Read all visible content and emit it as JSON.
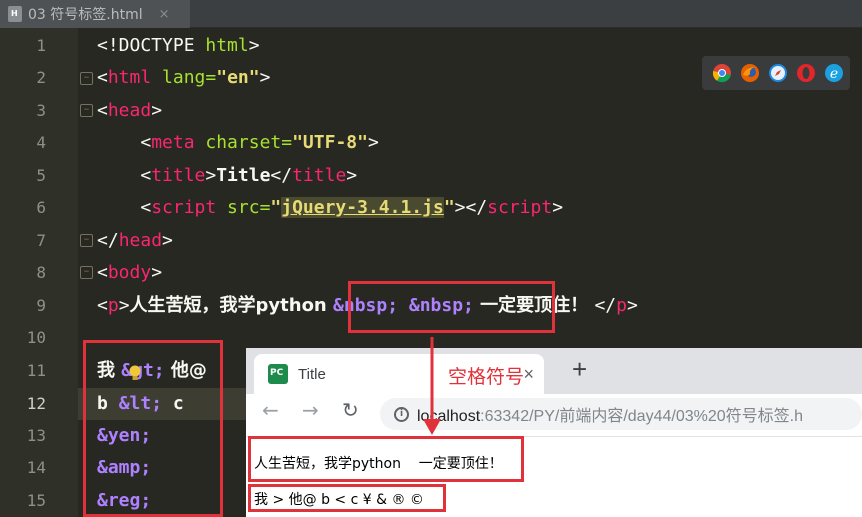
{
  "editor": {
    "tab_title": "03 符号标签.html",
    "tab_close": "×",
    "file_icon": "html-file-icon",
    "line_numbers": [
      "1",
      "2",
      "3",
      "4",
      "5",
      "6",
      "7",
      "8",
      "9",
      "10",
      "11",
      "12",
      "13",
      "14",
      "15"
    ],
    "current_line": "12",
    "lines": {
      "l1": {
        "a": "<!DOCTYPE ",
        "b": "html",
        "c": ">"
      },
      "l2": {
        "a": "<",
        "b": "html",
        "c": " lang=",
        "d": "\"en\"",
        "e": ">"
      },
      "l3": {
        "a": "<",
        "b": "head",
        "c": ">"
      },
      "l4": {
        "a": "    <",
        "b": "meta",
        "c": " charset=",
        "d": "\"UTF-8\"",
        "e": ">"
      },
      "l5": {
        "a": "    <",
        "b": "title",
        "c": ">",
        "d": "Title",
        "e": "</",
        "f": "title",
        "g": ">"
      },
      "l6": {
        "a": "    <",
        "b": "script",
        "c": " src=",
        "d": "\"",
        "e": "jQuery-3.4.1.js",
        "f": "\"",
        "g": "></",
        "h": "script",
        "i": ">"
      },
      "l7": {
        "a": "</",
        "b": "head",
        "c": ">"
      },
      "l8": {
        "a": "<",
        "b": "body",
        "c": ">"
      },
      "l9": {
        "a": "<",
        "b": "p",
        "c": ">",
        "d": "人生苦短，我学python ",
        "e": "&nbsp; &nbsp;",
        "f": " 一定要顶住！ ",
        "g": "</",
        "h": "p",
        "i": ">"
      },
      "l11": {
        "a": "我 ",
        "b": "&gt;",
        "c": " 他@"
      },
      "l12": {
        "a": "b ",
        "b": "&lt;",
        "c": " c"
      },
      "l13": {
        "a": "&yen;"
      },
      "l14": {
        "a": "&amp;"
      },
      "l15": {
        "a": "&reg;"
      }
    }
  },
  "browser_icons": [
    "chrome-icon",
    "firefox-icon",
    "safari-icon",
    "opera-icon",
    "ie-icon"
  ],
  "browser": {
    "tab_title": "Title",
    "tab_close": "×",
    "new_tab": "+",
    "back": "←",
    "forward": "→",
    "reload": "↻",
    "info": "i",
    "url_host": "localhost",
    "url_rest": ":63342/PY/前端内容/day44/03%20符号标签.h",
    "page_line1": "人生苦短，我学python    一定要顶住！",
    "page_line2": "我 > 他@ b < c ¥ & ® ©"
  },
  "annotation": "空格符号",
  "colors": {
    "highlight_box": "#e0323a",
    "tag": "#f92672",
    "attribute": "#a6e22e",
    "string": "#e6db74",
    "entity": "#ae81ff"
  }
}
